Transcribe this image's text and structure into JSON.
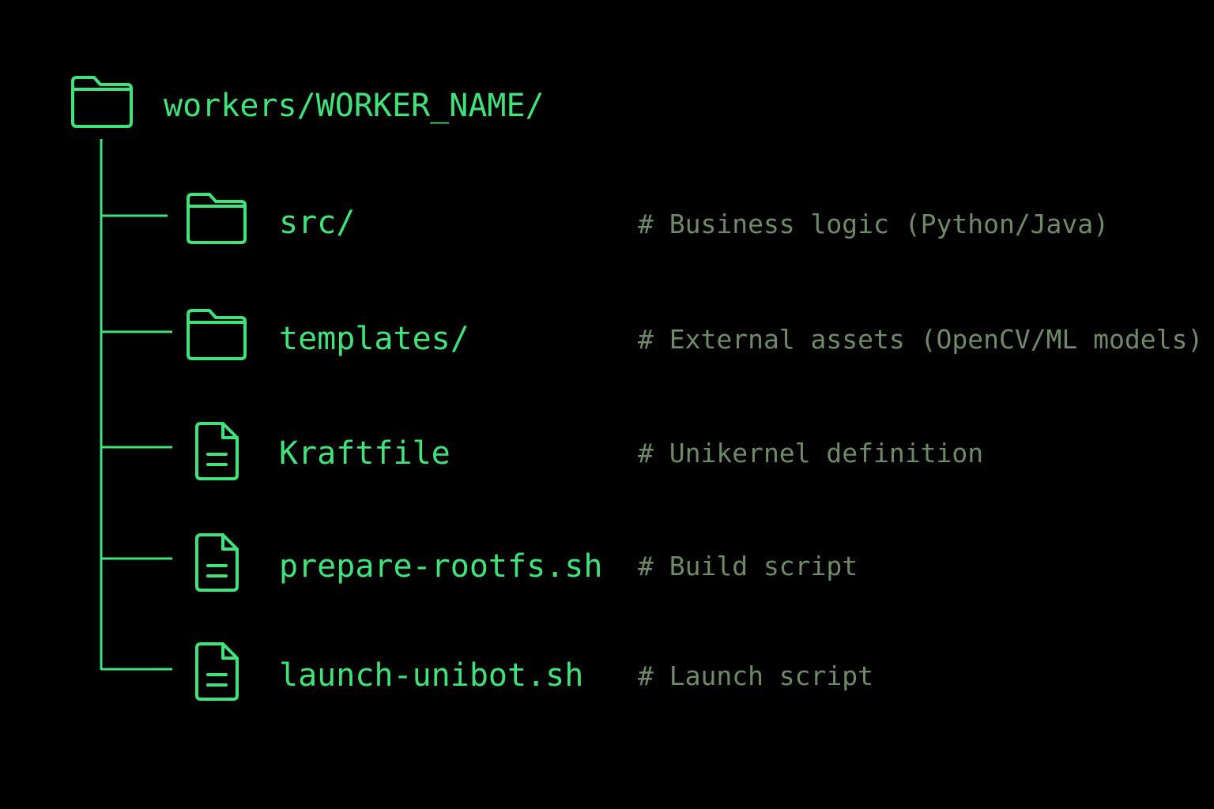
{
  "colors": {
    "background": "#000000",
    "accent_green": "#3fe37a",
    "comment_gray_green": "#6f8a66"
  },
  "root": {
    "icon": "folder-icon",
    "name": "workers/WORKER_NAME/"
  },
  "entries": [
    {
      "icon": "folder-icon",
      "name": "src/",
      "comment": "# Business logic (Python/Java)"
    },
    {
      "icon": "folder-icon",
      "name": "templates/",
      "comment": "# External assets (OpenCV/ML models)"
    },
    {
      "icon": "file-icon",
      "name": "Kraftfile",
      "comment": "# Unikernel definition"
    },
    {
      "icon": "file-icon",
      "name": "prepare-rootfs.sh",
      "comment": "# Build script"
    },
    {
      "icon": "file-icon",
      "name": "launch-unibot.sh",
      "comment": "# Launch script"
    }
  ]
}
